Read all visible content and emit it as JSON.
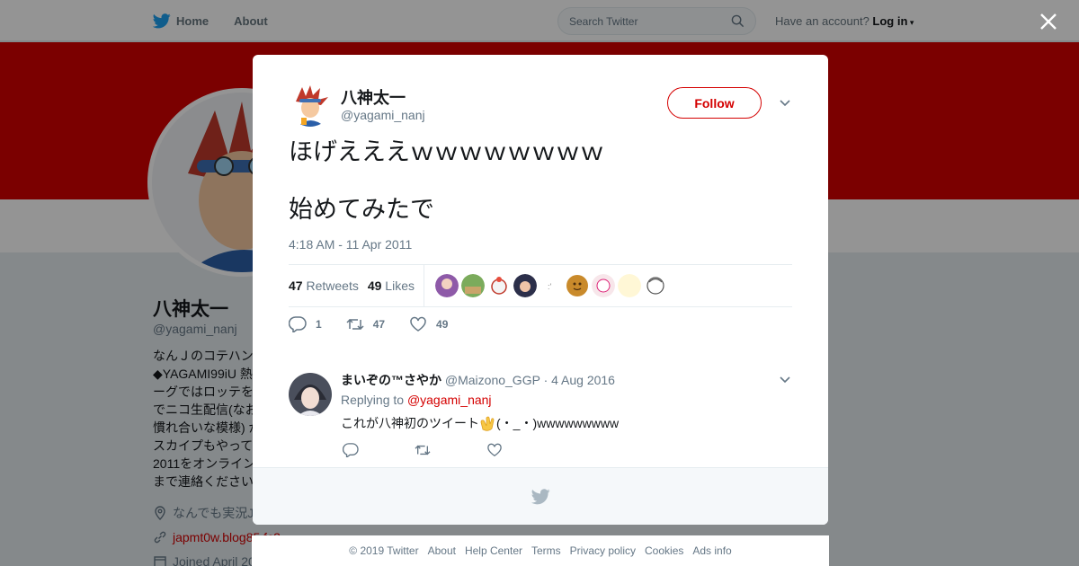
{
  "nav": {
    "home": "Home",
    "about": "About",
    "search_placeholder": "Search Twitter",
    "have_account": "Have an account?",
    "login": "Log in"
  },
  "profile": {
    "name": "八神太一",
    "handle": "@yagami_nanj",
    "bio": [
      "なんＪのコテハン",
      "◆YAGAMI99iU 熱",
      "ーグではロッテを",
      "でニコ生配信(なお",
      "慣れ合いな模様) が",
      "スカイプもやって",
      "2011をオンライン",
      "まで連絡ください"
    ],
    "location": "なんでも実況J",
    "url": "japmt0w.blog85.fc2",
    "joined": "Joined April 20"
  },
  "tweet": {
    "author_name": "八神太一",
    "author_handle": "@yagami_nanj",
    "follow_label": "Follow",
    "text_lines": [
      "ほげえええｗｗｗｗｗｗｗｗ",
      "始めてみたで"
    ],
    "timestamp": "4:18 AM - 11 Apr 2011",
    "retweets_count": "47",
    "retweets_label": "Retweets",
    "likes_count": "49",
    "likes_label": "Likes",
    "actions": {
      "reply_count": "1",
      "retweet_count": "47",
      "like_count": "49"
    }
  },
  "reply": {
    "name": "まいぞの™さやか",
    "handle": "@Maizono_GGP",
    "sep": "·",
    "date": "4 Aug 2016",
    "replying_to_label": "Replying to",
    "replying_to_handle": "@yagami_nanj",
    "text_before": "これが八神初のツイート",
    "text_after": "(・_・)wwwwwwwww"
  },
  "footer": {
    "links": [
      "© 2019 Twitter",
      "About",
      "Help Center",
      "Terms",
      "Privacy policy",
      "Cookies",
      "Ads info"
    ]
  },
  "colors": {
    "brand": "#d40000",
    "twitter_blue": "#1da1f2",
    "muted": "#657786"
  }
}
